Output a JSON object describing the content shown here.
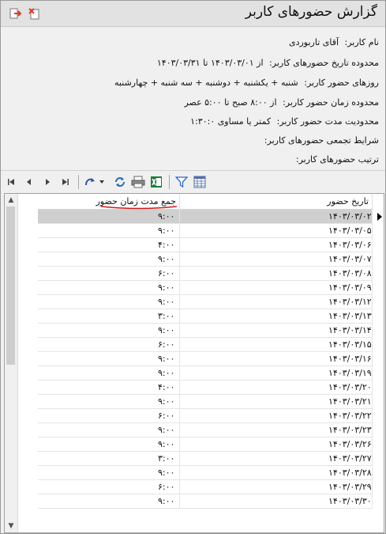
{
  "window": {
    "title": "گزارش حضورهای کاربر"
  },
  "info": [
    {
      "label": "نام کاربر:",
      "value": "آقای تاربوردی"
    },
    {
      "label": "محدوده تاریخ حضورهای کاربر:",
      "value": "از ۱۴۰۳/۰۳/۰۱ تا ۱۴۰۳/۰۳/۳۱"
    },
    {
      "label": "روزهای حضور کاربر:",
      "value": "شنبه + یکشنبه + دوشنبه + سه شنبه + چهارشنبه"
    },
    {
      "label": "محدوده زمان حضور کاربر:",
      "value": "از ۸:۰۰ صبح تا ۵:۰۰ عصر"
    },
    {
      "label": "محدودیت مدت حضور کاربر:",
      "value": "کمتر یا مساوی ۱:۳۰:۰"
    },
    {
      "label": "شرایط تجمعی حضورهای کاربر:",
      "value": ""
    },
    {
      "label": "ترتیب حضورهای کاربر:",
      "value": ""
    }
  ],
  "grid": {
    "columns": {
      "date": "تاریخ حضور",
      "duration": "جمع مدت زمان حضور"
    },
    "rows": [
      {
        "date": "۱۴۰۳/۰۳/۰۲",
        "duration": "۹:۰۰"
      },
      {
        "date": "۱۴۰۳/۰۳/۰۵",
        "duration": "۹:۰۰"
      },
      {
        "date": "۱۴۰۳/۰۳/۰۶",
        "duration": "۴:۰۰"
      },
      {
        "date": "۱۴۰۳/۰۳/۰۷",
        "duration": "۹:۰۰"
      },
      {
        "date": "۱۴۰۳/۰۳/۰۸",
        "duration": "۶:۰۰"
      },
      {
        "date": "۱۴۰۳/۰۳/۰۹",
        "duration": "۹:۰۰"
      },
      {
        "date": "۱۴۰۳/۰۳/۱۲",
        "duration": "۹:۰۰"
      },
      {
        "date": "۱۴۰۳/۰۳/۱۳",
        "duration": "۳:۰۰"
      },
      {
        "date": "۱۴۰۳/۰۳/۱۴",
        "duration": "۹:۰۰"
      },
      {
        "date": "۱۴۰۳/۰۳/۱۵",
        "duration": "۶:۰۰"
      },
      {
        "date": "۱۴۰۳/۰۳/۱۶",
        "duration": "۹:۰۰"
      },
      {
        "date": "۱۴۰۳/۰۳/۱۹",
        "duration": "۹:۰۰"
      },
      {
        "date": "۱۴۰۳/۰۳/۲۰",
        "duration": "۴:۰۰"
      },
      {
        "date": "۱۴۰۳/۰۳/۲۱",
        "duration": "۹:۰۰"
      },
      {
        "date": "۱۴۰۳/۰۳/۲۲",
        "duration": "۶:۰۰"
      },
      {
        "date": "۱۴۰۳/۰۳/۲۳",
        "duration": "۹:۰۰"
      },
      {
        "date": "۱۴۰۳/۰۳/۲۶",
        "duration": "۹:۰۰"
      },
      {
        "date": "۱۴۰۳/۰۳/۲۷",
        "duration": "۳:۰۰"
      },
      {
        "date": "۱۴۰۳/۰۳/۲۸",
        "duration": "۹:۰۰"
      },
      {
        "date": "۱۴۰۳/۰۳/۲۹",
        "duration": "۶:۰۰"
      },
      {
        "date": "۱۴۰۳/۰۳/۳۰",
        "duration": "۹:۰۰"
      }
    ]
  },
  "colors": {
    "selected_row": "#cfcfcf",
    "header_underline": "#d21b1b"
  }
}
